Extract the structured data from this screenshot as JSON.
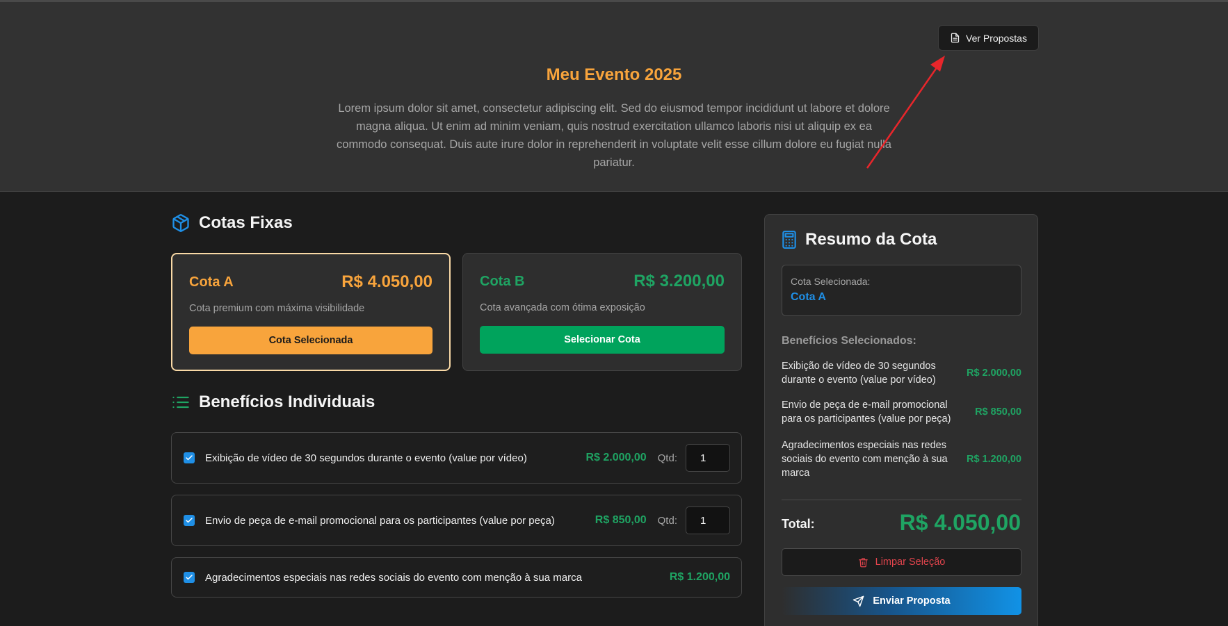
{
  "header": {
    "ver_propostas_label": "Ver Propostas",
    "title": "Meu Evento 2025",
    "description": "Lorem ipsum dolor sit amet, consectetur adipiscing elit. Sed do eiusmod tempor incididunt ut labore et dolore magna aliqua. Ut enim ad minim veniam, quis nostrud exercitation ullamco laboris nisi ut aliquip ex ea commodo consequat. Duis aute irure dolor in reprehenderit in voluptate velit esse cillum dolore eu fugiat nulla pariatur."
  },
  "cotas_fixas": {
    "title": "Cotas Fixas",
    "icon": "package-icon",
    "cards": [
      {
        "name": "Cota A",
        "price": "R$ 4.050,00",
        "description": "Cota premium com máxima visibilidade",
        "button_label": "Cota Selecionada",
        "selected": true
      },
      {
        "name": "Cota B",
        "price": "R$ 3.200,00",
        "description": "Cota avançada com ótima exposição",
        "button_label": "Selecionar Cota",
        "selected": false
      }
    ]
  },
  "beneficios": {
    "title": "Benefícios Individuais",
    "icon": "list-icon",
    "qtd_label": "Qtd:",
    "items": [
      {
        "label": "Exibição de vídeo de 30 segundos durante o evento (value por vídeo)",
        "price": "R$ 2.000,00",
        "checked": true,
        "quantity": "1"
      },
      {
        "label": "Envio de peça de e-mail promocional para os participantes (value por peça)",
        "price": "R$ 850,00",
        "checked": true,
        "quantity": "1"
      },
      {
        "label": "Agradecimentos especiais nas redes sociais do evento com menção à sua marca",
        "price": "R$ 1.200,00",
        "checked": true
      }
    ]
  },
  "resumo": {
    "title": "Resumo da Cota",
    "icon": "calculator-icon",
    "selected_label": "Cota Selecionada:",
    "selected_value": "Cota A",
    "beneficios_label": "Benefícios Selecionados:",
    "items": [
      {
        "label": "Exibição de vídeo de 30 segundos durante o evento (value por vídeo)",
        "price": "R$ 2.000,00"
      },
      {
        "label": "Envio de peça de e-mail promocional para os participantes (value por peça)",
        "price": "R$ 850,00"
      },
      {
        "label": "Agradecimentos especiais nas redes sociais do evento com menção à sua marca",
        "price": "R$ 1.200,00"
      }
    ],
    "total_label": "Total:",
    "total_value": "R$ 4.050,00",
    "clear_label": "Limpar Seleção",
    "send_label": "Enviar Proposta"
  },
  "colors": {
    "accent_orange": "#f8a43c",
    "accent_green": "#00a35c",
    "accent_blue": "#1f8fe6",
    "danger_red": "#e0444c"
  }
}
